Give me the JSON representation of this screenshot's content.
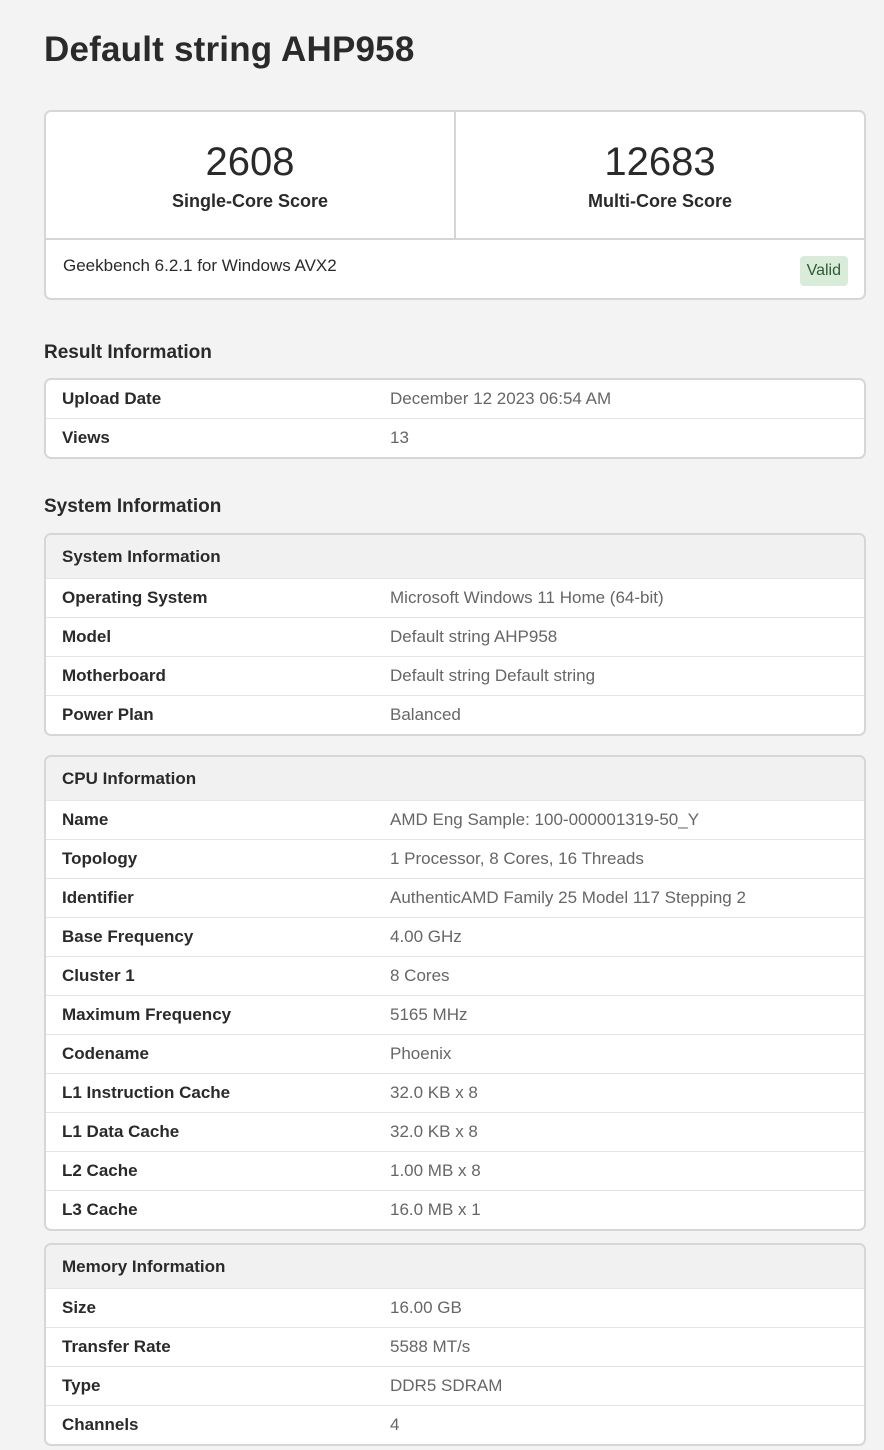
{
  "title": "Default string AHP958",
  "scores": {
    "single_value": "2608",
    "single_label": "Single-Core Score",
    "multi_value": "12683",
    "multi_label": "Multi-Core Score",
    "version": "Geekbench 6.2.1 for Windows AVX2",
    "status": "Valid"
  },
  "result_information": {
    "heading": "Result Information",
    "rows": [
      {
        "key": "Upload Date",
        "value": "December 12 2023 06:54 AM"
      },
      {
        "key": "Views",
        "value": "13"
      }
    ]
  },
  "system_information_heading": "System Information",
  "system_information": {
    "heading": "System Information",
    "rows": [
      {
        "key": "Operating System",
        "value": "Microsoft Windows 11 Home (64-bit)"
      },
      {
        "key": "Model",
        "value": "Default string AHP958"
      },
      {
        "key": "Motherboard",
        "value": "Default string Default string"
      },
      {
        "key": "Power Plan",
        "value": "Balanced"
      }
    ]
  },
  "cpu_information": {
    "heading": "CPU Information",
    "rows": [
      {
        "key": "Name",
        "value": "AMD Eng Sample: 100-000001319-50_Y"
      },
      {
        "key": "Topology",
        "value": "1 Processor, 8 Cores, 16 Threads"
      },
      {
        "key": "Identifier",
        "value": "AuthenticAMD Family 25 Model 117 Stepping 2"
      },
      {
        "key": "Base Frequency",
        "value": "4.00 GHz"
      },
      {
        "key": "Cluster 1",
        "value": "8 Cores"
      },
      {
        "key": "Maximum Frequency",
        "value": "5165 MHz"
      },
      {
        "key": "Codename",
        "value": "Phoenix"
      },
      {
        "key": "L1 Instruction Cache",
        "value": "32.0 KB x 8"
      },
      {
        "key": "L1 Data Cache",
        "value": "32.0 KB x 8"
      },
      {
        "key": "L2 Cache",
        "value": "1.00 MB x 8"
      },
      {
        "key": "L3 Cache",
        "value": "16.0 MB x 1"
      }
    ]
  },
  "memory_information": {
    "heading": "Memory Information",
    "rows": [
      {
        "key": "Size",
        "value": "16.00 GB"
      },
      {
        "key": "Transfer Rate",
        "value": "5588 MT/s"
      },
      {
        "key": "Type",
        "value": "DDR5 SDRAM"
      },
      {
        "key": "Channels",
        "value": "4"
      }
    ]
  },
  "colors": {
    "page_background": "#f3f3f3",
    "valid_badge_background": "#d8ecd9",
    "valid_badge_text": "#2f5b33"
  }
}
